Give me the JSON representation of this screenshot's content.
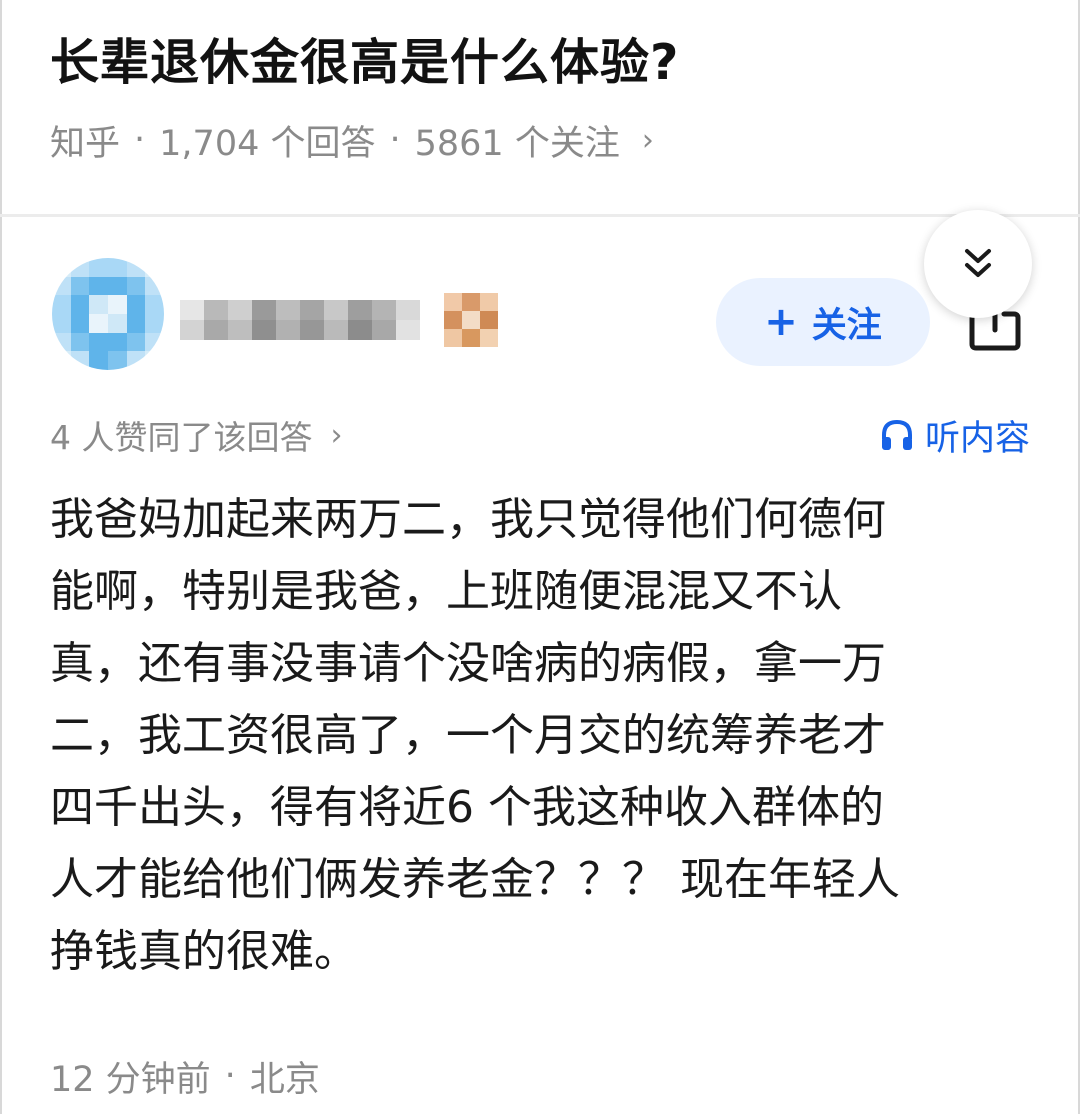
{
  "question": {
    "title": "长辈退休金很高是什么体验?",
    "source": "知乎",
    "separator": "·",
    "answers_count": "1,704 个回答",
    "followers_count": "5861 个关注",
    "chevron": "›"
  },
  "author": {
    "follow_plus": "+",
    "follow_label": "关注",
    "share_icon": "share-icon",
    "expand_icon": "double-chevron-down-icon"
  },
  "answer": {
    "likes_text": "4 人赞同了该回答",
    "likes_chevron": "›",
    "listen_icon": "headphones-icon",
    "listen_label": "听内容",
    "content_lines": [
      "我爸妈加起来两万二，我只觉得他们何德何",
      "能啊，特别是我爸，上班随便混混又不认",
      "真，还有事没事请个没啥病的病假，拿一万",
      "二，我工资很高了，一个月交的统筹养老才",
      "四千出头，得有将近6 个我这种收入群体的",
      "人才能给他们俩发养老金？？？ 现在年轻人",
      "挣钱真的很难。"
    ],
    "time": "12 分钟前",
    "separator": "·",
    "location": "北京"
  },
  "colors": {
    "accent": "#1762e6",
    "follow_bg": "#eaf2ff",
    "meta_gray": "#8a8a8a",
    "text": "#1a1a1a"
  }
}
